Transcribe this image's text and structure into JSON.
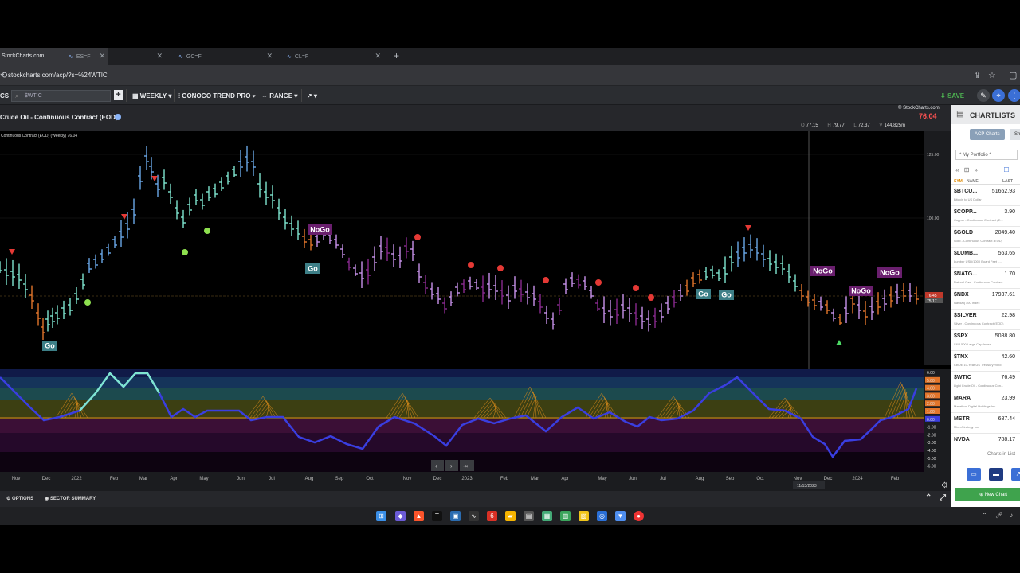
{
  "browser": {
    "tabs": [
      {
        "label": "StockCharts.com",
        "active": true
      },
      {
        "label": "ES=F",
        "active": false
      },
      {
        "label": "GC=F",
        "active": false
      },
      {
        "label": "CL=F",
        "active": false
      }
    ],
    "new_tab": "+",
    "url": "stockcharts.com/acp/?s=%24WTIC"
  },
  "toolbar": {
    "brand_fragment": "CS",
    "symbol_placeholder": "$WTIC",
    "add_label": "+",
    "period_label": "WEEKLY",
    "indicator_label": "GONOGO TREND PRO",
    "range_label": "RANGE",
    "save_label": "SAVE"
  },
  "chart_header": {
    "title": "Crude Oil - Continuous Contract (EOD)",
    "brand": "© StockCharts.com",
    "last_price": "76.04",
    "ohlc": [
      {
        "k": "O",
        "v": "77.15"
      },
      {
        "k": "H",
        "v": "79.77"
      },
      {
        "k": "L",
        "v": "72.37"
      },
      {
        "k": "V",
        "v": "144.825m"
      }
    ]
  },
  "chart_data": {
    "type": "bar",
    "legend": "Continuous Contract (EOD) (Weekly) 76.04",
    "price_axis": {
      "ticks": [
        "125.00",
        "100.00",
        "75.00"
      ],
      "tag_last": "76.45",
      "tag_close": "75.17"
    },
    "x_ticks": [
      {
        "label": "Nov"
      },
      {
        "label": "Dec"
      },
      {
        "label": "2022"
      },
      {
        "label": "Feb"
      },
      {
        "label": "Mar"
      },
      {
        "label": "Apr"
      },
      {
        "label": "May"
      },
      {
        "label": "Jun"
      },
      {
        "label": "Jul"
      },
      {
        "label": "Aug"
      },
      {
        "label": "Sep"
      },
      {
        "label": "Oct"
      },
      {
        "label": "Nov"
      },
      {
        "label": "Dec"
      },
      {
        "label": "2023"
      },
      {
        "label": "Feb"
      },
      {
        "label": "Mar"
      },
      {
        "label": "Apr"
      },
      {
        "label": "May"
      },
      {
        "label": "Jun"
      },
      {
        "label": "Jul"
      },
      {
        "label": "Aug"
      },
      {
        "label": "Sep"
      },
      {
        "label": "Oct"
      },
      {
        "label": "Nov"
      },
      {
        "label": "Dec"
      },
      {
        "label": "2024"
      },
      {
        "label": "Feb"
      }
    ],
    "crosshair_date": "11/13/2023",
    "signals": [
      {
        "text": "Go"
      },
      {
        "text": "NoGo"
      },
      {
        "text": "Go"
      },
      {
        "text": "Go"
      },
      {
        "text": "Go"
      },
      {
        "text": "NoGo"
      },
      {
        "text": "NoGo"
      },
      {
        "text": "NoGo"
      }
    ],
    "oscillator": {
      "ticks": [
        "6.00",
        "5.00",
        "4.00",
        "3.00",
        "2.00",
        "1.00",
        "0.00",
        "-1.00",
        "-2.00",
        "-3.00",
        "-4.00",
        "-5.00",
        "-6.00"
      ]
    }
  },
  "bottom_bar": {
    "options": "OPTIONS",
    "sector_summary": "SECTOR SUMMARY"
  },
  "chartlist": {
    "title": "CHARTLISTS",
    "tab_acp": "ACP Charts",
    "tab_shared": "Sha",
    "portfolio": "* My Portfolio *",
    "col_sym": "SYM",
    "col_name": "NAME",
    "col_last": "LAST",
    "rows": [
      {
        "sym": "$BTCU...",
        "last": "51662.93",
        "desc": "Bitcoin to US Dollar"
      },
      {
        "sym": "$COPP...",
        "last": "3.90",
        "desc": "Copper - Continuous Contract (E..."
      },
      {
        "sym": "$GOLD",
        "last": "2049.40",
        "desc": "Gold - Continuous Contract (EOD)"
      },
      {
        "sym": "$LUMB...",
        "last": "563.65",
        "desc": "Lumber USD/1000 Board Feet -..."
      },
      {
        "sym": "$NATG...",
        "last": "1.70",
        "desc": "Natural Gas - Continuous Contract"
      },
      {
        "sym": "$NDX",
        "last": "17937.61",
        "desc": "Nasdaq 100 Index"
      },
      {
        "sym": "$SILVER",
        "last": "22.98",
        "desc": "Silver - Continuous Contract (EOD)"
      },
      {
        "sym": "$SPX",
        "last": "5088.80",
        "desc": "S&P 500 Large Cap Index"
      },
      {
        "sym": "$TNX",
        "last": "42.60",
        "desc": "CBOE 10-Year US Treasury Yield"
      },
      {
        "sym": "$WTIC",
        "last": "76.49",
        "desc": "Light Crude Oil - Continuous Con..."
      },
      {
        "sym": "MARA",
        "last": "23.99",
        "desc": "Marathon Digital Holdings Inc"
      },
      {
        "sym": "MSTR",
        "last": "687.44",
        "desc": "MicroStrategy Inc"
      },
      {
        "sym": "NVDA",
        "last": "788.17",
        "desc": ""
      }
    ],
    "charts_in_list": "Charts in List",
    "new_chart": "New Chart"
  }
}
